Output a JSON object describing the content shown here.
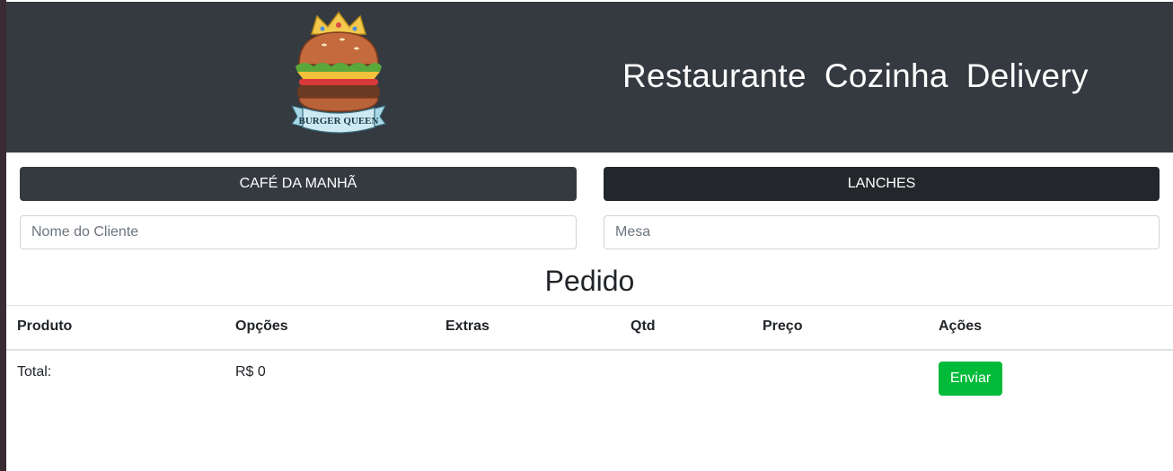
{
  "header": {
    "logo_text": "BURGER QUEEN",
    "nav": [
      "Restaurante",
      "Cozinha",
      "Delivery"
    ]
  },
  "menu": {
    "breakfast_label": "CAFÉ DA MANHÃ",
    "lunch_label": "LANCHES"
  },
  "form": {
    "client_placeholder": "Nome do Cliente",
    "table_placeholder": "Mesa"
  },
  "order": {
    "title": "Pedido",
    "columns": [
      "Produto",
      "Opções",
      "Extras",
      "Qtd",
      "Preço",
      "Ações"
    ],
    "total_label": "Total:",
    "total_value": "R$ 0",
    "send_label": "Enviar"
  },
  "colors": {
    "header_bg": "#343a40",
    "send_button": "#00bb3a"
  },
  "icons": [
    "burger-logo"
  ]
}
